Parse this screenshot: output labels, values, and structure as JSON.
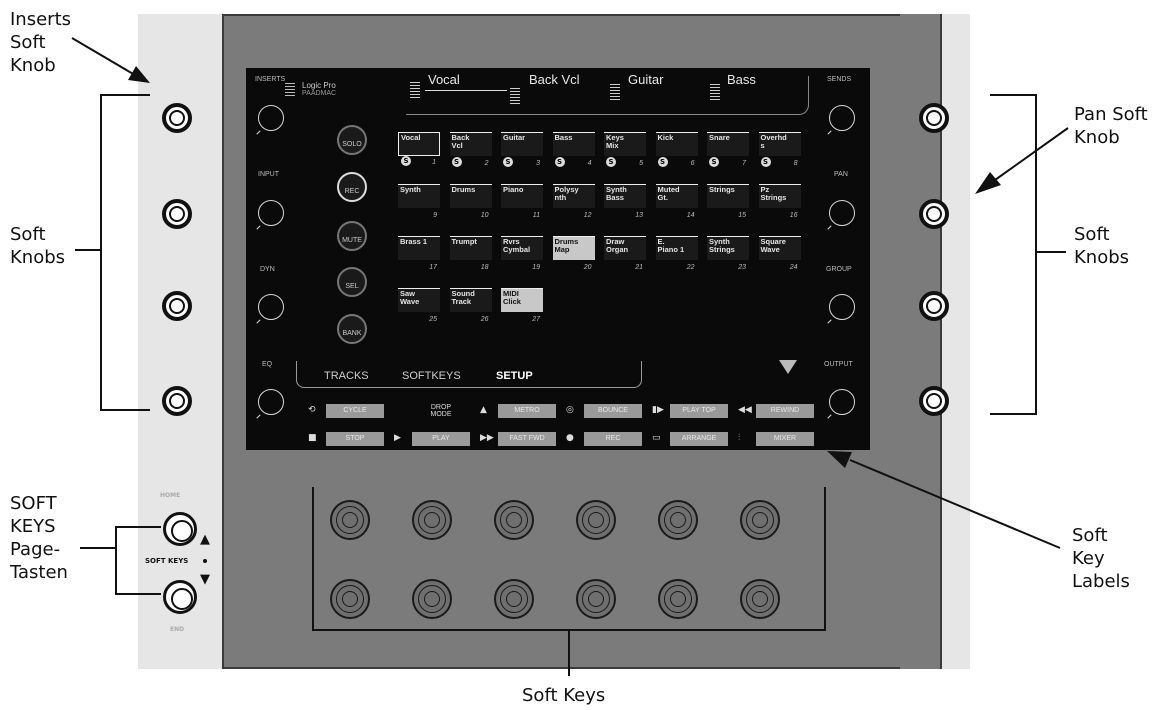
{
  "annotations": {
    "inserts_soft_knob": "Inserts\nSoft\nKnob",
    "soft_knobs_left": "Soft\nKnobs",
    "soft_keys_page": "SOFT\nKEYS\nPage-\nTasten",
    "pan_soft_knob": "Pan Soft\nKnob",
    "soft_knobs_right": "Soft\nKnobs",
    "soft_key_labels": "Soft\nKey\nLabels",
    "soft_keys": "Soft Keys"
  },
  "device": {
    "home_label": "HOME",
    "end_label": "END",
    "soft_keys_label": "SOFT KEYS"
  },
  "screen": {
    "left_labels": [
      "INSERTS",
      "INPUT",
      "DYN",
      "EQ"
    ],
    "right_labels": [
      "SENDS",
      "PAN",
      "GROUP",
      "OUTPUT"
    ],
    "logo_title": "Logic Pro",
    "logo_sub": "PAADMAC",
    "channels": [
      "Vocal",
      "Back Vcl",
      "Guitar",
      "Bass"
    ],
    "channel_buttons": [
      "SOLO",
      "REC",
      "MUTE",
      "SEL",
      "BANK"
    ],
    "tracks": [
      {
        "name": "Vocal",
        "num": "1",
        "s": "S"
      },
      {
        "name": "Back\nVcl",
        "num": "2",
        "s": "S"
      },
      {
        "name": "Guitar",
        "num": "3",
        "s": "S"
      },
      {
        "name": "Bass",
        "num": "4",
        "s": "S"
      },
      {
        "name": "Keys\nMix",
        "num": "5",
        "s": "S"
      },
      {
        "name": "Kick",
        "num": "6",
        "s": "S"
      },
      {
        "name": "Snare",
        "num": "7",
        "s": "S"
      },
      {
        "name": "Overhd\ns",
        "num": "8",
        "s": "S"
      },
      {
        "name": "Synth",
        "num": "9"
      },
      {
        "name": "Drums",
        "num": "10"
      },
      {
        "name": "Piano",
        "num": "11"
      },
      {
        "name": "Polysy\nnth",
        "num": "12"
      },
      {
        "name": "Synth\nBass",
        "num": "13"
      },
      {
        "name": "Muted\nGt.",
        "num": "14"
      },
      {
        "name": "Strings",
        "num": "15"
      },
      {
        "name": "Pz\nStrings",
        "num": "16"
      },
      {
        "name": "Brass 1",
        "num": "17"
      },
      {
        "name": "Trumpt",
        "num": "18"
      },
      {
        "name": "Rvrs\nCymbal",
        "num": "19"
      },
      {
        "name": "Drums\nMap",
        "num": "20"
      },
      {
        "name": "Draw\nOrgan",
        "num": "21"
      },
      {
        "name": "E.\nPiano 1",
        "num": "22"
      },
      {
        "name": "Synth\nStrings",
        "num": "23"
      },
      {
        "name": "Square\nWave",
        "num": "24"
      },
      {
        "name": "Saw\nWave",
        "num": "25"
      },
      {
        "name": "Sound\nTrack",
        "num": "26"
      },
      {
        "name": "MIDI\nClick",
        "num": "27"
      }
    ],
    "tabs": [
      "TRACKS",
      "SOFTKEYS",
      "SETUP"
    ],
    "softkey_row1": [
      "CYCLE",
      "DROP\nMODE",
      "METRO",
      "BOUNCE",
      "PLAY TOP",
      "REWIND"
    ],
    "softkey_row2": [
      "STOP",
      "PLAY",
      "FAST FWD",
      "REC",
      "ARRANGE",
      "MIXER"
    ]
  }
}
